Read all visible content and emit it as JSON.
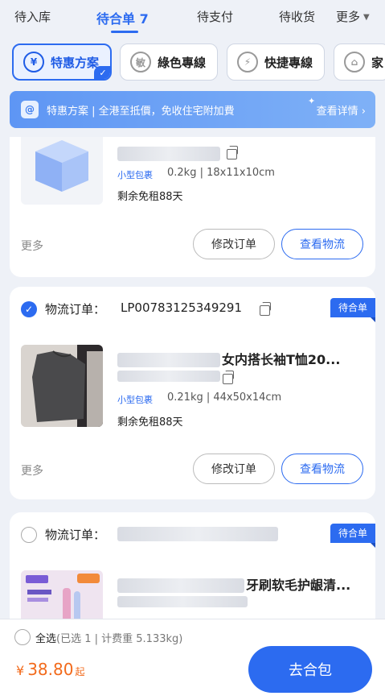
{
  "tabs": [
    "待入库",
    "待合单 7",
    "待支付",
    "待收货",
    "更多"
  ],
  "plans": [
    {
      "icon_text": "¥",
      "label": "特惠方案",
      "selected": true
    },
    {
      "icon_text": "敏",
      "label": "綠色專線",
      "selected": false
    },
    {
      "icon_text": "⚡",
      "label": "快捷專線",
      "selected": false
    },
    {
      "icon_text": "⌂",
      "label": "家",
      "selected": false
    }
  ],
  "banner": {
    "icon_text": "@",
    "text": "特惠方案 | 全港至抵價，免收住宅附加費",
    "link": "查看详情"
  },
  "card1": {
    "package_tag": "小型包裹",
    "spec": "0.2kg | 18x11x10cm",
    "rent": "剩余免租88天",
    "more": "更多",
    "btn_modify": "修改订单",
    "btn_track": "查看物流"
  },
  "card2": {
    "order_label": "物流订单：",
    "order_no": "LP00783125349291",
    "status": "待合单",
    "title": "女内搭长袖T恤20...",
    "package_tag": "小型包裹",
    "spec": "0.21kg | 44x50x14cm",
    "rent": "剩余免租88天",
    "more": "更多",
    "btn_modify": "修改订单",
    "btn_track": "查看物流"
  },
  "card3": {
    "order_label": "物流订单：",
    "status": "待合单",
    "title": "牙刷软毛护龈清..."
  },
  "footer": {
    "select_all": "全选",
    "selection_info": "(已选 1 | 计费重 5.133kg)",
    "currency": "¥",
    "price": "38.80",
    "price_suffix": "起",
    "checkout": "去合包"
  }
}
